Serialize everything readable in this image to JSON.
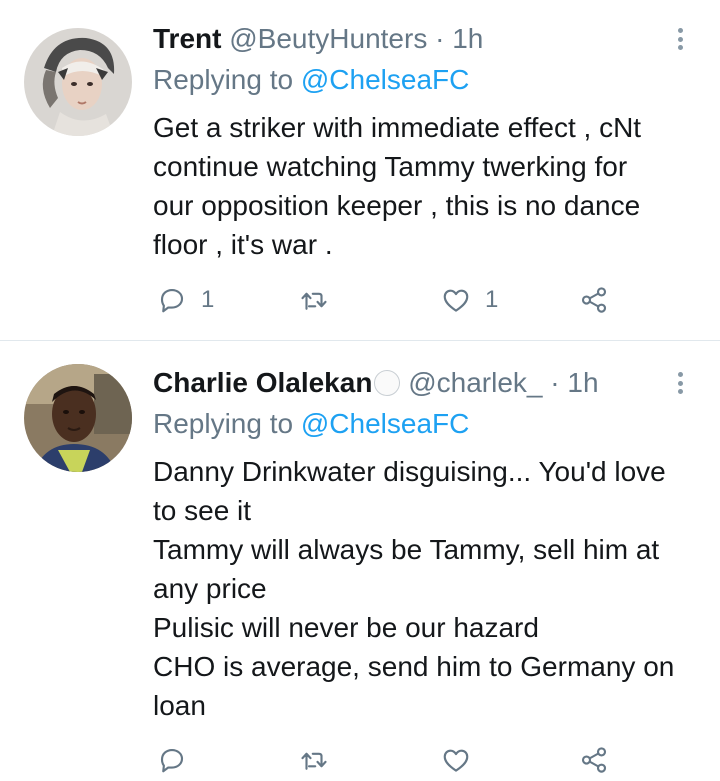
{
  "tweets": [
    {
      "name": "Trent",
      "handle": "@BeutyHunters",
      "separator": "·",
      "time": "1h",
      "replying_prefix": "Replying to ",
      "replying_to": "@ChelseaFC",
      "lines": [
        "Get a striker with immediate effect , cNt",
        "continue watching Tammy  twerking for",
        "our opposition keeper , this is no dance",
        "floor , it's war ."
      ],
      "replies": "1",
      "retweets": "",
      "likes": "1"
    },
    {
      "name": "Charlie Olalekan",
      "handle": "@charlek_",
      "separator": "·",
      "time": "1h",
      "replying_prefix": "Replying to ",
      "replying_to": "@ChelseaFC",
      "lines": [
        "Danny Drinkwater disguising... You'd love",
        "to see it",
        "Tammy will always be Tammy, sell him at",
        "any price",
        "Pulisic will never be our hazard",
        "CHO is average, send him to Germany on",
        "loan"
      ],
      "replies": "",
      "retweets": "",
      "likes": ""
    }
  ],
  "icons": {
    "reply": "reply-icon",
    "retweet": "retweet-icon",
    "like": "heart-icon",
    "share": "share-icon",
    "more": "more-vertical-icon"
  },
  "colors": {
    "text": "#14171a",
    "muted": "#657786",
    "link": "#1da1f2",
    "icon": "#657786",
    "divider": "#e1e8ed"
  }
}
